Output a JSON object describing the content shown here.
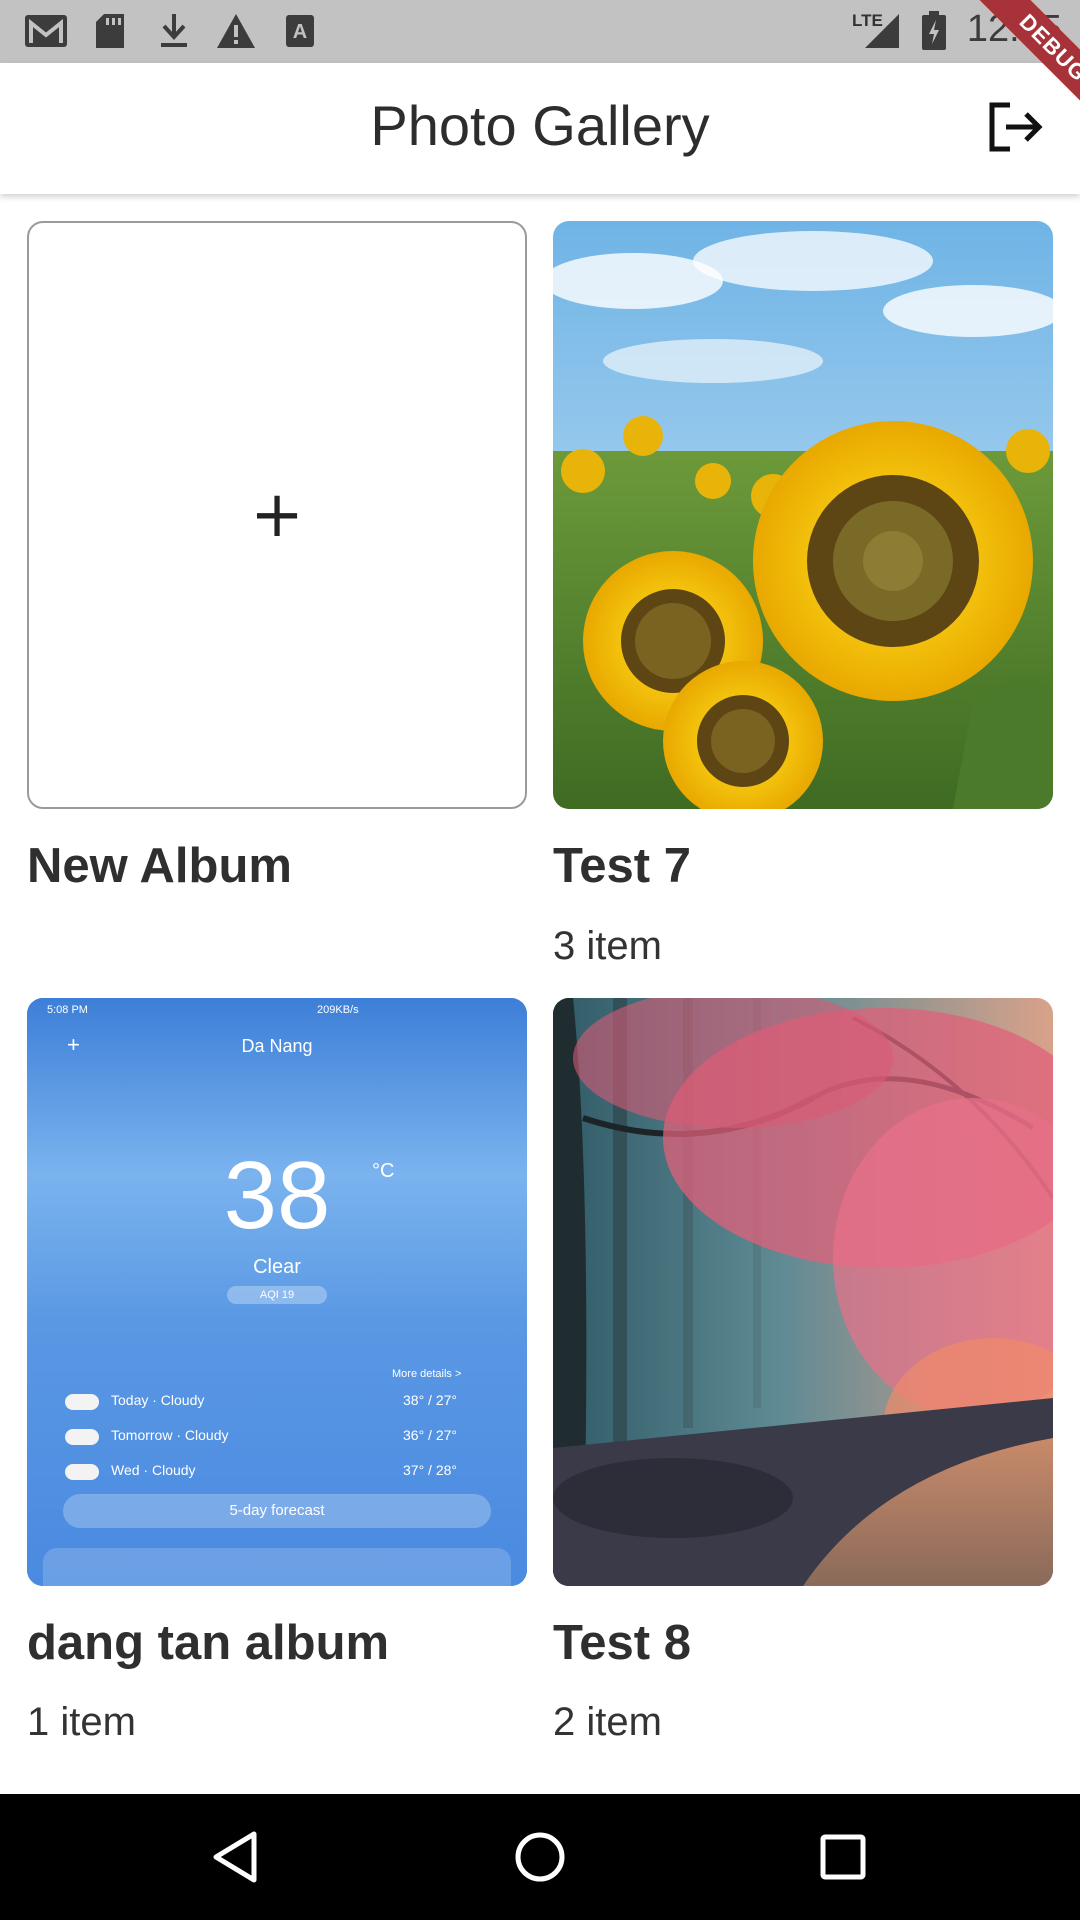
{
  "status_bar": {
    "time": "12:55",
    "network": "LTE",
    "icons": [
      "gmail-icon",
      "sd-card-icon",
      "download-icon",
      "warning-icon",
      "a-icon",
      "signal-icon",
      "battery-icon"
    ]
  },
  "app_bar": {
    "title": "Photo Gallery",
    "action_icon": "logout-icon",
    "debug_label": "DEBUG"
  },
  "albums": [
    {
      "name": "New Album",
      "count": "",
      "kind": "add",
      "icon": "plus-icon"
    },
    {
      "name": "Test 7",
      "count": "3 item",
      "kind": "photo",
      "image": "sunflowers"
    },
    {
      "name": "dang tan album",
      "count": "1 item",
      "kind": "screenshot",
      "image": "weather-screenshot"
    },
    {
      "name": "Test 8",
      "count": "2 item",
      "kind": "photo",
      "image": "red-forest"
    }
  ],
  "weather_thumb": {
    "status_time": "5:08 PM",
    "status_speed": "209KB/s",
    "city": "Da Nang",
    "temp": "38",
    "unit": "°C",
    "condition": "Clear",
    "aqi": "AQI 19",
    "more_details": "More details >",
    "forecast": [
      {
        "day": "Today · Cloudy",
        "range": "38° / 27°"
      },
      {
        "day": "Tomorrow · Cloudy",
        "range": "36° / 27°"
      },
      {
        "day": "Wed · Cloudy",
        "range": "37° / 28°"
      }
    ],
    "forecast_button": "5-day forecast"
  },
  "nav_bar": {
    "buttons": [
      "back-button",
      "home-button",
      "recents-button"
    ]
  },
  "colors": {
    "status_bar": "#c2c2c2",
    "debug_ribbon": "#a8323a",
    "nav_bar": "#000000",
    "weather_blue": "#4a8fe0"
  }
}
